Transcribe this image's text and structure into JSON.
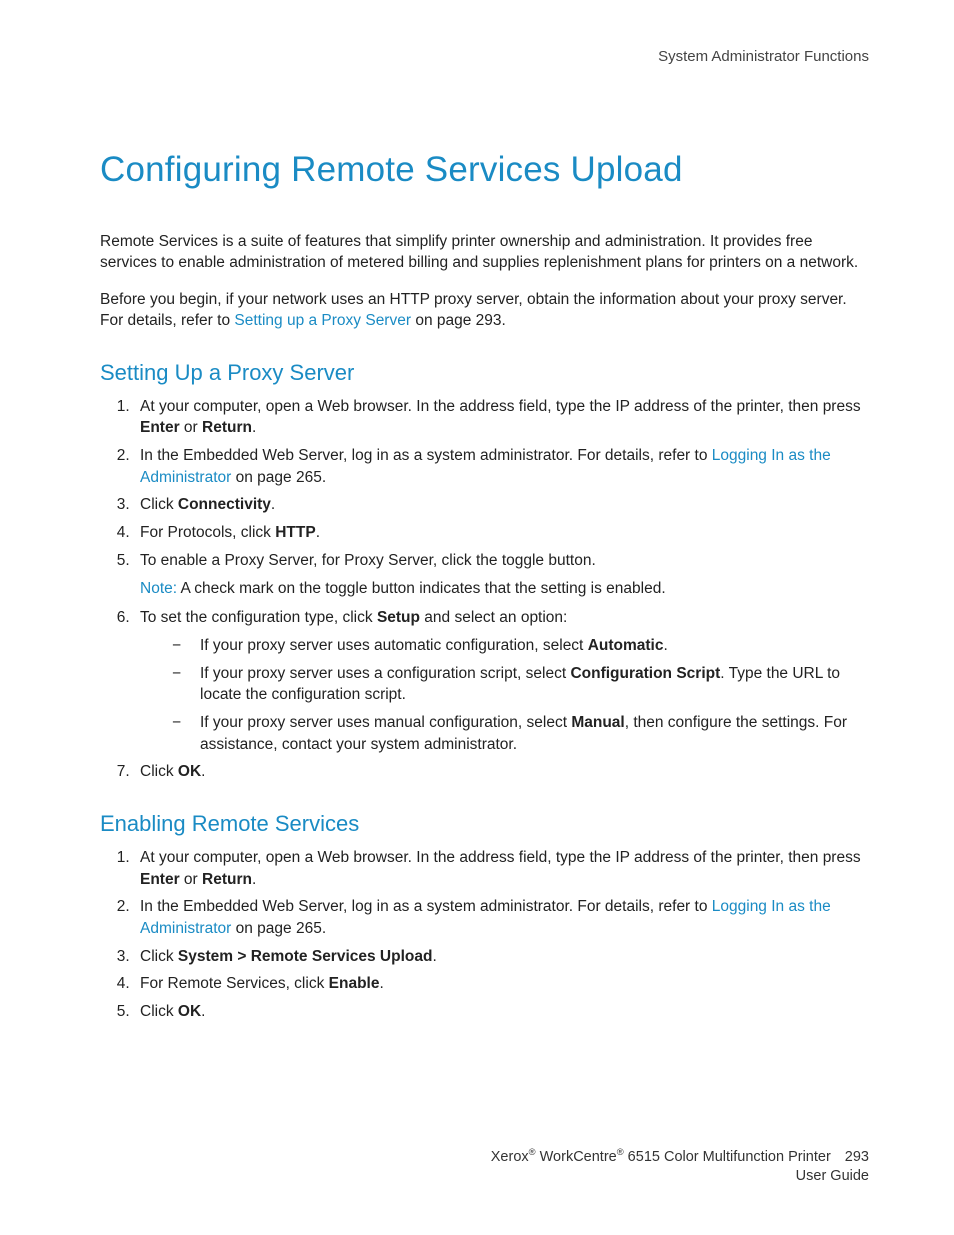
{
  "header": {
    "section": "System Administrator Functions"
  },
  "title": "Configuring Remote Services Upload",
  "intro1": "Remote Services is a suite of features that simplify printer ownership and administration. It provides free services to enable administration of metered billing and supplies replenishment plans for printers on a network.",
  "intro2_pre": "Before you begin, if your network uses an HTTP proxy server, obtain the information about your proxy server. For details, refer to ",
  "intro2_link": "Setting up a Proxy Server",
  "intro2_post": " on page 293.",
  "section1": {
    "heading": "Setting Up a Proxy Server",
    "step1_a": "At your computer, open a Web browser. In the address field, type the IP address of the printer, then press ",
    "step1_b": "Enter",
    "step1_c": " or ",
    "step1_d": "Return",
    "step1_e": ".",
    "step2_a": "In the Embedded Web Server, log in as a system administrator. For details, refer to ",
    "step2_link": "Logging In as the Administrator",
    "step2_b": " on page 265.",
    "step3_a": "Click ",
    "step3_b": "Connectivity",
    "step3_c": ".",
    "step4_a": "For Protocols, click ",
    "step4_b": "HTTP",
    "step4_c": ".",
    "step5": "To enable a Proxy Server, for Proxy Server, click the toggle button.",
    "note_label": "Note:",
    "note_text": " A check mark on the toggle button indicates that the setting is enabled.",
    "step6_a": "To set the configuration type, click ",
    "step6_b": "Setup",
    "step6_c": " and select an option:",
    "sub1_a": "If your proxy server uses automatic configuration, select ",
    "sub1_b": "Automatic",
    "sub1_c": ".",
    "sub2_a": "If your proxy server uses a configuration script, select ",
    "sub2_b": "Configuration Script",
    "sub2_c": ". Type the URL to locate the configuration script.",
    "sub3_a": "If your proxy server uses manual configuration, select ",
    "sub3_b": "Manual",
    "sub3_c": ", then configure the settings. For assistance, contact your system administrator.",
    "step7_a": "Click ",
    "step7_b": "OK",
    "step7_c": "."
  },
  "section2": {
    "heading": "Enabling Remote Services",
    "step1_a": "At your computer, open a Web browser. In the address field, type the IP address of the printer, then press ",
    "step1_b": "Enter",
    "step1_c": " or ",
    "step1_d": "Return",
    "step1_e": ".",
    "step2_a": "In the Embedded Web Server, log in as a system administrator. For details, refer to ",
    "step2_link": "Logging In as the Administrator",
    "step2_b": " on page 265.",
    "step3_a": "Click ",
    "step3_b": "System > Remote Services Upload",
    "step3_c": ".",
    "step4_a": "For Remote Services, click ",
    "step4_b": "Enable",
    "step4_c": ".",
    "step5_a": "Click ",
    "step5_b": "OK",
    "step5_c": "."
  },
  "footer": {
    "line1_a": "Xerox",
    "line1_b": " WorkCentre",
    "line1_c": " 6515 Color Multifunction Printer",
    "page_number": "293",
    "line2": "User Guide",
    "reg": "®"
  }
}
